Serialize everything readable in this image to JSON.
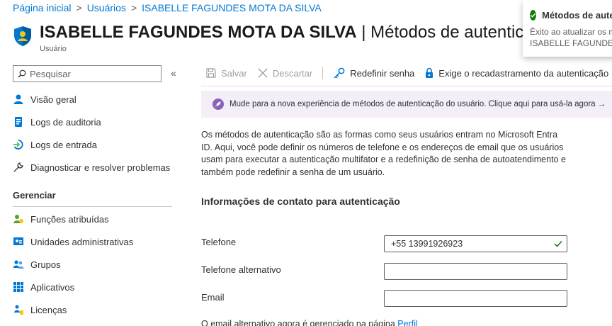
{
  "breadcrumb": [
    "Página inicial",
    "Usuários",
    "ISABELLE FAGUNDES MOTA DA SILVA"
  ],
  "header": {
    "title_name": "ISABELLE FAGUNDES MOTA DA SILVA",
    "title_sep": " | ",
    "title_rest": "Métodos de autenticação",
    "subtitle": "Usuário"
  },
  "sidebar": {
    "search_placeholder": "Pesquisar",
    "collapse": "«",
    "items": [
      {
        "label": "Visão geral",
        "icon": "user-icon"
      },
      {
        "label": "Logs de auditoria",
        "icon": "log-icon"
      },
      {
        "label": "Logs de entrada",
        "icon": "signin-icon"
      },
      {
        "label": "Diagnosticar e resolver problemas",
        "icon": "wrench-icon"
      }
    ],
    "section": "Gerenciar",
    "manage_items": [
      {
        "label": "Funções atribuídas",
        "icon": "roles-icon"
      },
      {
        "label": "Unidades administrativas",
        "icon": "admin-units-icon"
      },
      {
        "label": "Grupos",
        "icon": "groups-icon"
      },
      {
        "label": "Aplicativos",
        "icon": "apps-icon"
      },
      {
        "label": "Licenças",
        "icon": "license-icon"
      }
    ]
  },
  "toolbar": {
    "save": "Salvar",
    "discard": "Descartar",
    "reset_password": "Redefinir senha",
    "require_reregister": "Exige o recadastramento da autenticação"
  },
  "banner": {
    "text": "Mude para a nova experiência de métodos de autenticação do usuário. Clique aqui para usá-la agora →"
  },
  "main": {
    "description": "Os métodos de autenticação são as formas como seus usuários entram no Microsoft Entra ID. Aqui, você pode definir os números de telefone e os endereços de email que os usuários usam para executar a autenticação multifator e a redefinição de senha de autoatendimento e também pode redefinir a senha de um usuário.",
    "section_title": "Informações de contato para autenticação",
    "fields": [
      {
        "label": "Telefone",
        "value": "+55 13991926923"
      },
      {
        "label": "Telefone alternativo",
        "value": ""
      },
      {
        "label": "Email",
        "value": ""
      }
    ],
    "footer_text": "O email alternativo agora é gerenciado na página ",
    "footer_link": "Perfil"
  },
  "toast": {
    "title": "Métodos de autenticação",
    "body_line1": "Êxito ao atualizar os métodos",
    "body_line2": "ISABELLE FAGUNDES MOTA DA SILVA"
  },
  "colors": {
    "accent": "#0078d4",
    "success": "#107c10",
    "banner_bg": "#f3eef8",
    "banner_icon": "#8764b8"
  }
}
